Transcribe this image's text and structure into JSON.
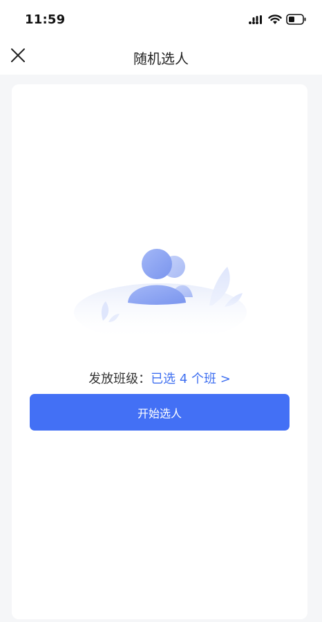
{
  "status_bar": {
    "time": "11:59"
  },
  "nav": {
    "title": "随机选人",
    "close_icon": "close-icon"
  },
  "main": {
    "class_label": "发放班级：",
    "class_selection": "已选 4 个班 >",
    "start_button": "开始选人",
    "illustration_icon": "people-illustration"
  },
  "colors": {
    "accent": "#4370f5",
    "link": "#3d6ef0",
    "background": "#f5f6f8",
    "card": "#ffffff"
  }
}
